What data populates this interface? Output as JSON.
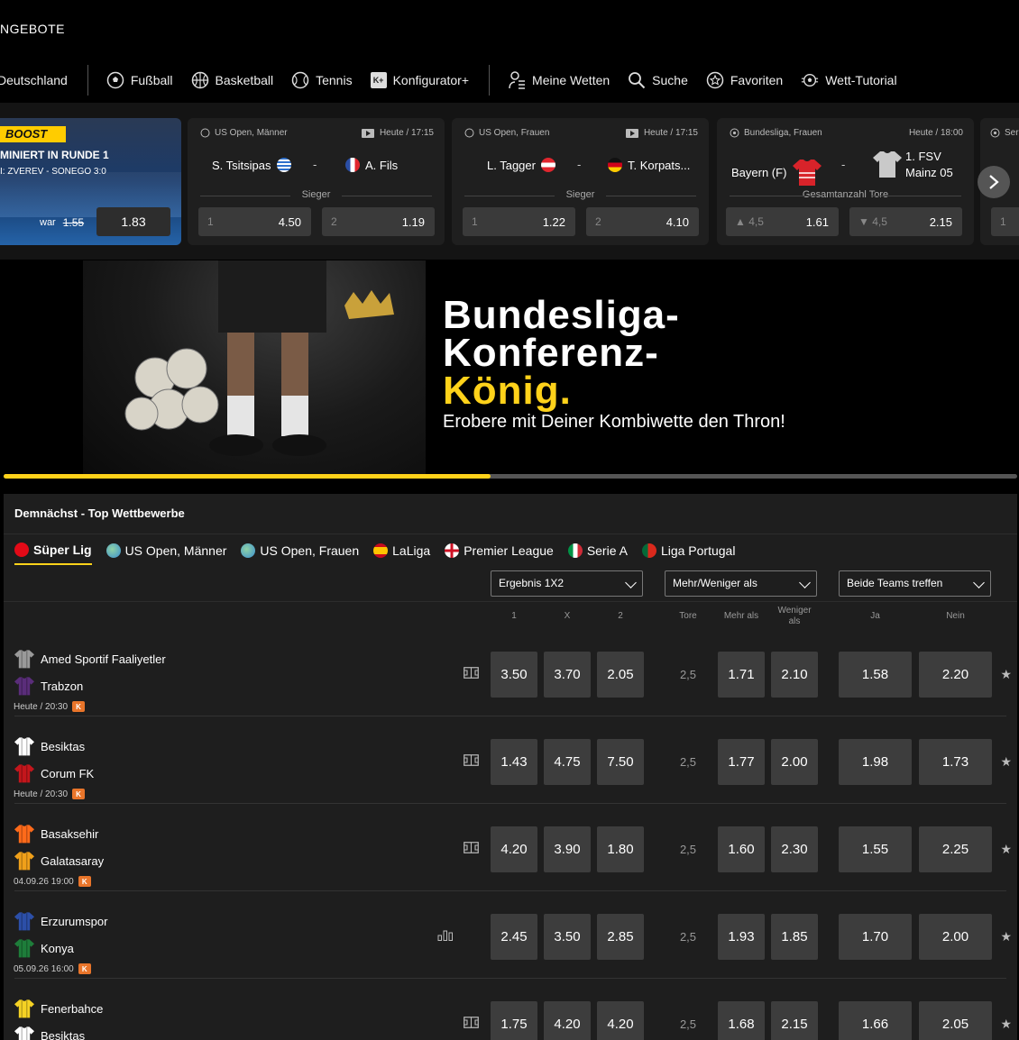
{
  "header": {
    "angebote": "NGEBOTE",
    "nav": [
      {
        "label": "Deutschland",
        "icon": "none"
      },
      {
        "label": "Fußball",
        "icon": "soccer-ball-icon"
      },
      {
        "label": "Basketball",
        "icon": "basketball-icon"
      },
      {
        "label": "Tennis",
        "icon": "tennis-ball-icon"
      },
      {
        "label": "Konfigurator+",
        "icon": "konfigurator-icon"
      },
      {
        "label": "Meine Wetten",
        "icon": "bet-slip-icon"
      },
      {
        "label": "Suche",
        "icon": "search-icon"
      },
      {
        "label": "Favoriten",
        "icon": "star-icon"
      },
      {
        "label": "Wett-Tutorial",
        "icon": "tutorial-icon"
      }
    ]
  },
  "boost": {
    "badge": "BOOST",
    "headline": "MINIERT IN RUNDE 1",
    "sub": "I: ZVEREV - SONEGO 3:0",
    "war_label": "war",
    "old_odd": "1.55",
    "new_odd": "1.83"
  },
  "cards": [
    {
      "competition": "US Open, Männer",
      "time": "Heute / 17:15",
      "home": "S. Tsitsipas",
      "away": "A. Fils",
      "market": "Sieger",
      "o1_label": "1",
      "o1_val": "4.50",
      "o2_label": "2",
      "o2_val": "1.19"
    },
    {
      "competition": "US Open, Frauen",
      "time": "Heute / 17:15",
      "home": "L. Tagger",
      "away": "T. Korpats...",
      "market": "Sieger",
      "o1_label": "1",
      "o1_val": "1.22",
      "o2_label": "2",
      "o2_val": "4.10"
    },
    {
      "competition": "Bundesliga, Frauen",
      "time": "Heute / 18:00",
      "home": "Bayern (F)",
      "away_line1": "1. FSV",
      "away_line2": "Mainz 05",
      "market": "Gesamtanzahl Tore",
      "o1_label": "▲ 4,5",
      "o1_val": "1.61",
      "o2_label": "▼ 4,5",
      "o2_val": "2.15"
    },
    {
      "competition": "Ser",
      "o1_label": "1"
    }
  ],
  "banner": {
    "line1": "Bundesliga-",
    "line2": "Konferenz-",
    "line3": "König.",
    "line4": "Erobere mit Deiner Kombiwette den Thron!",
    "progress": 0.48
  },
  "section": {
    "title": "Demnächst - Top Wettbewerbe",
    "tabs": [
      "Süper Lig",
      "US Open, Männer",
      "US Open, Frauen",
      "LaLiga",
      "Premier League",
      "Serie A",
      "Liga Portugal"
    ],
    "selects": [
      "Ergebnis 1X2",
      "Mehr/Weniger als",
      "Beide Teams treffen"
    ],
    "col_headers": [
      "1",
      "X",
      "2",
      "Tore",
      "Mehr als",
      "Weniger als",
      "Ja",
      "Nein"
    ],
    "matches": [
      {
        "home": "Amed Sportif Faaliyetler",
        "away": "Trabzon",
        "kickoff": "Heute / 20:30",
        "o1": "3.50",
        "ox": "3.70",
        "o2": "2.05",
        "tore": "2,5",
        "mehr": "1.71",
        "weniger": "2.10",
        "ja": "1.58",
        "nein": "2.20"
      },
      {
        "home": "Besiktas",
        "away": "Corum FK",
        "kickoff": "Heute / 20:30",
        "o1": "1.43",
        "ox": "4.75",
        "o2": "7.50",
        "tore": "2,5",
        "mehr": "1.77",
        "weniger": "2.00",
        "ja": "1.98",
        "nein": "1.73"
      },
      {
        "home": "Basaksehir",
        "away": "Galatasaray",
        "kickoff": "04.09.26 19:00",
        "o1": "4.20",
        "ox": "3.90",
        "o2": "1.80",
        "tore": "2,5",
        "mehr": "1.60",
        "weniger": "2.30",
        "ja": "1.55",
        "nein": "2.25"
      },
      {
        "home": "Erzurumspor",
        "away": "Konya",
        "kickoff": "05.09.26 16:00",
        "o1": "2.45",
        "ox": "3.50",
        "o2": "2.85",
        "tore": "2,5",
        "mehr": "1.93",
        "weniger": "1.85",
        "ja": "1.70",
        "nein": "2.00"
      },
      {
        "home": "Fenerbahce",
        "away": "Besiktas",
        "kickoff": "",
        "o1": "1.75",
        "ox": "4.20",
        "o2": "4.20",
        "tore": "2,5",
        "mehr": "1.68",
        "weniger": "2.15",
        "ja": "1.66",
        "nein": "2.05"
      }
    ],
    "kbadge": "K"
  },
  "colors": {
    "accent": "#ffd21a",
    "card": "#1f1f1f",
    "odd_bg": "#3d3d3d",
    "kbadge": "#e9752a"
  }
}
